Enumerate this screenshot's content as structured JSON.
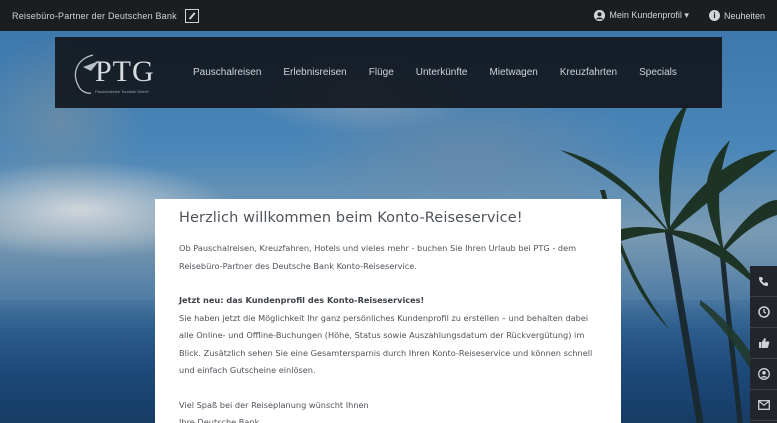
{
  "topbar": {
    "partner_text": "Reisebüro-Partner der Deutschen Bank",
    "profile_label": "Mein Kundenprofil ▾",
    "news_label": "Neuheiten"
  },
  "logo": {
    "text": "PTG",
    "tagline": "Pauschalreise Touristik GmbH"
  },
  "nav": {
    "items": [
      "Pauschalreisen",
      "Erlebnisreisen",
      "Flüge",
      "Unterkünfte",
      "Mietwagen",
      "Kreuzfahrten",
      "Specials"
    ]
  },
  "welcome": {
    "title": "Herzlich willkommen beim Konto-Reiseservice!",
    "intro": "Ob Pauschalreisen, Kreuzfahren, Hotels und vieles mehr - buchen Sie Ihren Urlaub bei PTG - dem Reisebüro-Partner des Deutsche Bank Konto-Reiseservice.",
    "news_heading": "Jetzt neu: das Kundenprofil des Konto-Reiseservices!",
    "news_text": "Sie haben jetzt die Möglichkeit Ihr ganz persönliches Kundenprofil zu erstellen – und behalten dabei alle Online- und Offline-Buchungen (Höhe, Status sowie Auszahlungsdatum der Rückvergütung) im Blick. Zusätzlich sehen Sie eine Gesamtersparnis durch Ihren Konto-Reiseservice und können schnell und einfach Gutscheine einlösen.",
    "closing": "Viel Spaß bei der Reiseplanung wünscht Ihnen",
    "signature": "Ihre Deutsche Bank"
  },
  "side_toolbar": {
    "icons": [
      "phone-icon",
      "clock-icon",
      "thumbs-up-icon",
      "user-icon",
      "envelope-icon"
    ]
  },
  "colors": {
    "topbar_bg": "#1b1d21",
    "nav_bg": "#13181f",
    "card_bg": "#ffffff",
    "text": "#4e535b"
  }
}
